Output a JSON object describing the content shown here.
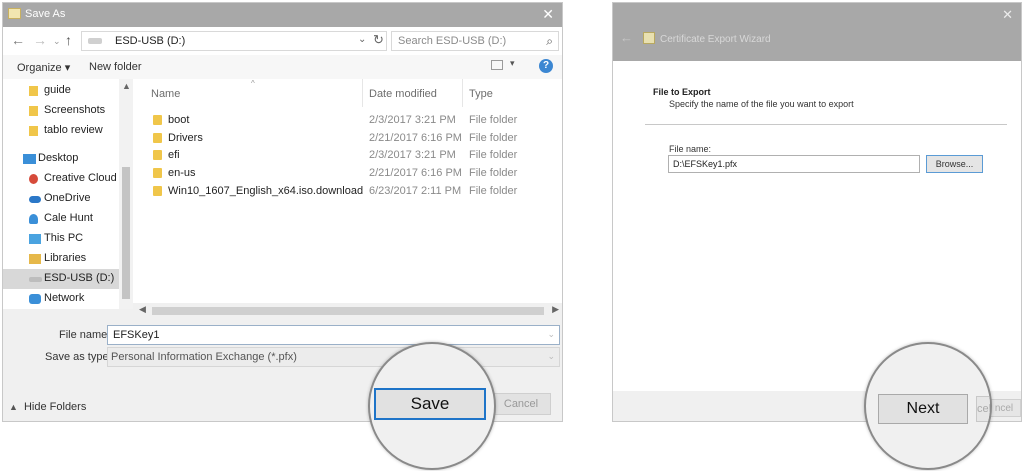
{
  "save_dialog": {
    "title": "Save As",
    "close": "✕",
    "address": "ESD-USB (D:)",
    "search_placeholder": "Search ESD-USB (D:)",
    "toolbar": {
      "organize": "Organize ▾",
      "new_folder": "New folder",
      "help": "?"
    },
    "nav_items": [
      {
        "label": "guide"
      },
      {
        "label": "Screenshots"
      },
      {
        "label": "tablo review"
      },
      {
        "label": "Desktop"
      },
      {
        "label": "Creative Cloud Fi"
      },
      {
        "label": "OneDrive"
      },
      {
        "label": "Cale Hunt"
      },
      {
        "label": "This PC"
      },
      {
        "label": "Libraries"
      },
      {
        "label": "ESD-USB (D:)"
      },
      {
        "label": "Network"
      }
    ],
    "columns": {
      "name": "Name",
      "date": "Date modified",
      "type": "Type"
    },
    "files": [
      {
        "name": "boot",
        "date": "2/3/2017 3:21 PM",
        "type": "File folder"
      },
      {
        "name": "Drivers",
        "date": "2/21/2017 6:16 PM",
        "type": "File folder"
      },
      {
        "name": "efi",
        "date": "2/3/2017 3:21 PM",
        "type": "File folder"
      },
      {
        "name": "en-us",
        "date": "2/21/2017 6:16 PM",
        "type": "File folder"
      },
      {
        "name": "Win10_1607_English_x64.iso.download",
        "date": "6/23/2017 2:11 PM",
        "type": "File folder"
      }
    ],
    "file_name_label": "File name:",
    "file_name_value": "EFSKey1",
    "save_as_type_label": "Save as type:",
    "save_as_type_value": "Personal Information Exchange (*.pfx)",
    "hide_folders": "Hide Folders",
    "save_button": "Save",
    "cancel_button": "Cancel"
  },
  "wizard": {
    "title": "Certificate Export Wizard",
    "close": "✕",
    "heading": "File to Export",
    "subheading": "Specify the name of the file you want to export",
    "file_name_label": "File name:",
    "file_name_value": "D:\\EFSKey1.pfx",
    "browse_button": "Browse...",
    "next_button": "Next",
    "cancel_partial": "ncel",
    "cancel_zoom_partial": "cel"
  }
}
